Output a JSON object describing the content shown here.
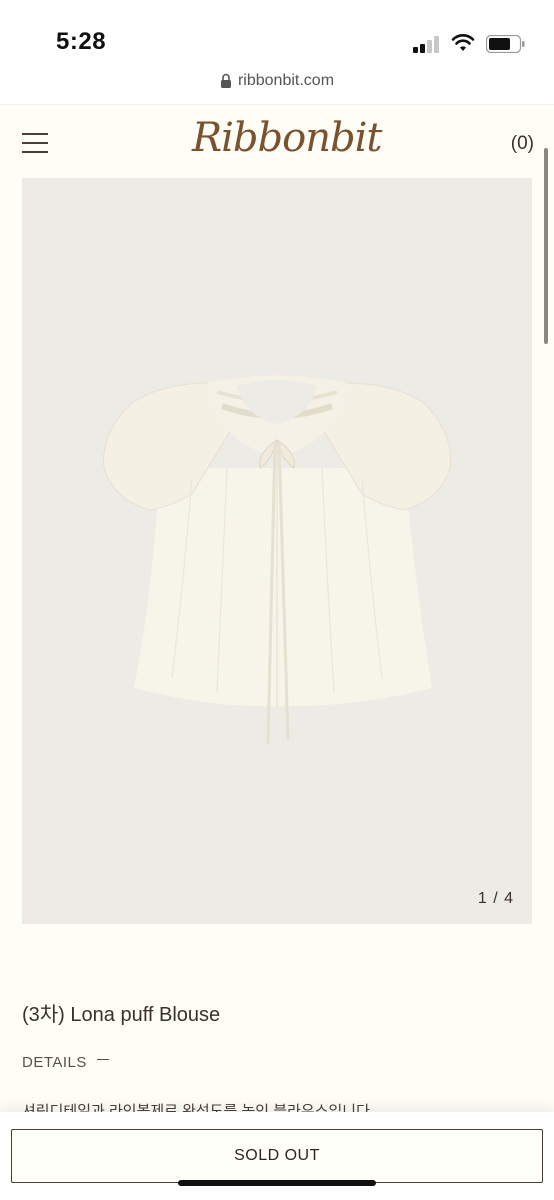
{
  "status_bar": {
    "time": "5:28"
  },
  "browser": {
    "url": "ribbonbit.com",
    "icons": [
      "lock-icon"
    ]
  },
  "header": {
    "logo": "Ribbonbit",
    "cart_count": "(0)",
    "menu_icon": "hamburger-icon"
  },
  "gallery": {
    "counter": "1 / 4",
    "image_subject": "cream puff-sleeve blouse with neck ribbon"
  },
  "product": {
    "title": "(3차) Lona puff Blouse",
    "details_label": "DETAILS",
    "description_partial": "셔링디테일과 라인볼제로 완성도를 높인 블라우스입니다"
  },
  "actions": {
    "sold_out_label": "SOLD OUT"
  },
  "colors": {
    "accent": "#7a5230",
    "background": "#fefdf6",
    "image_bg": "#edebe6"
  }
}
